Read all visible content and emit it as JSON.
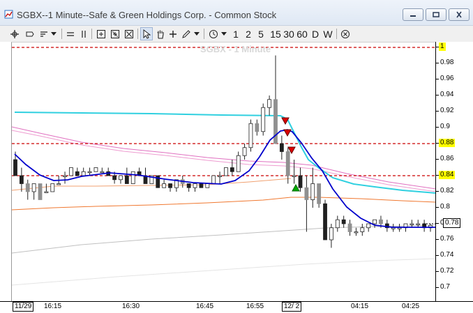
{
  "window": {
    "title": "SGBX--1 Minute--Safe & Green Holdings Corp. - Common Stock",
    "controls": [
      "minimize",
      "restore",
      "close"
    ]
  },
  "toolbar": {
    "intervals": [
      "1",
      "2",
      "5",
      "15",
      "30",
      "60",
      "D",
      "W"
    ],
    "tools": [
      "crosshair-icon",
      "label-icon",
      "sort-icon",
      "chevron-down-icon",
      "line-icon",
      "parallel-lines-icon",
      "zoom-in-icon",
      "zoom-out-icon",
      "zoom-fit-icon",
      "pointer-icon",
      "hand-icon",
      "plus-icon",
      "pencil-icon",
      "chevron-down-icon",
      "clock-icon",
      "chevron-down-icon",
      "cancel-icon"
    ]
  },
  "chart": {
    "watermark": "SGBX - 1 Minute",
    "y_labels": [
      "1",
      "0.98",
      "0.96",
      "0.94",
      "0.92",
      "0.9",
      "0.88",
      "0.86",
      "0.84",
      "0.82",
      "0.8",
      "0.78",
      "0.76",
      "0.74",
      "0.72",
      "0.7"
    ],
    "highlighted_levels": [
      "1",
      "0.88",
      "0.84"
    ],
    "last_price": "0.78",
    "x_labels": [
      "11/29",
      "16:15",
      "16:30",
      "16:45",
      "16:55",
      "12/ 2",
      "04:15",
      "04:25"
    ],
    "date_labels": [
      "11/29",
      "12/ 2"
    ],
    "colors": {
      "dashed_level": "#cc0000",
      "ma_fast": "#0000cc",
      "ma_cyan": "#30d0e0",
      "ma_pink": "#e070c0",
      "ma_orange": "#f07830",
      "ma_gray": "#c0c0c0",
      "candle_up": "#ffffff",
      "candle_down": "#202020",
      "candle_gray": "#909090",
      "buy_arrow": "#00aa00",
      "sell_arrow": "#dd0000"
    }
  },
  "chart_data": {
    "type": "candlestick",
    "title": "SGBX - 1 Minute",
    "ylim": [
      0.7,
      1.0
    ],
    "price_levels": [
      1.0,
      0.88,
      0.84
    ],
    "last_price": 0.78,
    "candles": [
      [
        0.86,
        0.87,
        0.84,
        0.84
      ],
      [
        0.84,
        0.85,
        0.82,
        0.83
      ],
      [
        0.83,
        0.835,
        0.81,
        0.82
      ],
      [
        0.82,
        0.83,
        0.81,
        0.83
      ],
      [
        0.83,
        0.83,
        0.81,
        0.81
      ],
      [
        0.82,
        0.83,
        0.82,
        0.82
      ],
      [
        0.82,
        0.83,
        0.82,
        0.83
      ],
      [
        0.83,
        0.84,
        0.83,
        0.83
      ],
      [
        0.84,
        0.845,
        0.83,
        0.84
      ],
      [
        0.84,
        0.85,
        0.84,
        0.85
      ],
      [
        0.845,
        0.85,
        0.84,
        0.84
      ],
      [
        0.84,
        0.85,
        0.84,
        0.845
      ],
      [
        0.845,
        0.85,
        0.84,
        0.845
      ],
      [
        0.845,
        0.85,
        0.845,
        0.85
      ],
      [
        0.845,
        0.85,
        0.845,
        0.845
      ],
      [
        0.845,
        0.85,
        0.84,
        0.84
      ],
      [
        0.84,
        0.845,
        0.83,
        0.835
      ],
      [
        0.835,
        0.84,
        0.83,
        0.84
      ],
      [
        0.84,
        0.85,
        0.83,
        0.83
      ],
      [
        0.83,
        0.845,
        0.83,
        0.845
      ],
      [
        0.845,
        0.85,
        0.84,
        0.84
      ],
      [
        0.84,
        0.85,
        0.83,
        0.83
      ],
      [
        0.83,
        0.84,
        0.83,
        0.84
      ],
      [
        0.84,
        0.84,
        0.825,
        0.825
      ],
      [
        0.825,
        0.835,
        0.825,
        0.83
      ],
      [
        0.83,
        0.83,
        0.82,
        0.825
      ],
      [
        0.825,
        0.835,
        0.82,
        0.835
      ],
      [
        0.835,
        0.84,
        0.825,
        0.83
      ],
      [
        0.83,
        0.83,
        0.82,
        0.825
      ],
      [
        0.825,
        0.83,
        0.82,
        0.83
      ],
      [
        0.83,
        0.83,
        0.825,
        0.825
      ],
      [
        0.825,
        0.83,
        0.825,
        0.83
      ],
      [
        0.83,
        0.84,
        0.83,
        0.84
      ],
      [
        0.84,
        0.845,
        0.83,
        0.84
      ],
      [
        0.84,
        0.85,
        0.84,
        0.85
      ],
      [
        0.85,
        0.86,
        0.84,
        0.845
      ],
      [
        0.845,
        0.87,
        0.845,
        0.865
      ],
      [
        0.865,
        0.88,
        0.86,
        0.875
      ],
      [
        0.875,
        0.91,
        0.87,
        0.905
      ],
      [
        0.905,
        0.91,
        0.89,
        0.895
      ],
      [
        0.895,
        0.93,
        0.89,
        0.925
      ],
      [
        0.925,
        0.94,
        0.915,
        0.935
      ],
      [
        0.935,
        0.99,
        0.9,
        0.88
      ],
      [
        0.88,
        0.89,
        0.86,
        0.87
      ],
      [
        0.87,
        0.875,
        0.83,
        0.84
      ],
      [
        0.84,
        0.86,
        0.83,
        0.84
      ],
      [
        0.84,
        0.85,
        0.82,
        0.825
      ],
      [
        0.825,
        0.84,
        0.77,
        0.81
      ],
      [
        0.81,
        0.85,
        0.8,
        0.83
      ],
      [
        0.83,
        0.83,
        0.8,
        0.805
      ],
      [
        0.805,
        0.81,
        0.76,
        0.76
      ],
      [
        0.76,
        0.78,
        0.75,
        0.775
      ],
      [
        0.775,
        0.79,
        0.77,
        0.785
      ],
      [
        0.785,
        0.79,
        0.775,
        0.78
      ],
      [
        0.78,
        0.785,
        0.765,
        0.77
      ],
      [
        0.77,
        0.775,
        0.765,
        0.77
      ],
      [
        0.77,
        0.78,
        0.765,
        0.775
      ],
      [
        0.775,
        0.78,
        0.77,
        0.78
      ],
      [
        0.78,
        0.785,
        0.775,
        0.785
      ],
      [
        0.785,
        0.79,
        0.775,
        0.78
      ],
      [
        0.78,
        0.785,
        0.77,
        0.775
      ],
      [
        0.775,
        0.78,
        0.77,
        0.775
      ],
      [
        0.775,
        0.78,
        0.77,
        0.775
      ],
      [
        0.775,
        0.78,
        0.77,
        0.78
      ],
      [
        0.78,
        0.785,
        0.775,
        0.78
      ],
      [
        0.78,
        0.785,
        0.775,
        0.78
      ],
      [
        0.78,
        0.785,
        0.77,
        0.775
      ],
      [
        0.775,
        0.78,
        0.77,
        0.778
      ]
    ]
  }
}
